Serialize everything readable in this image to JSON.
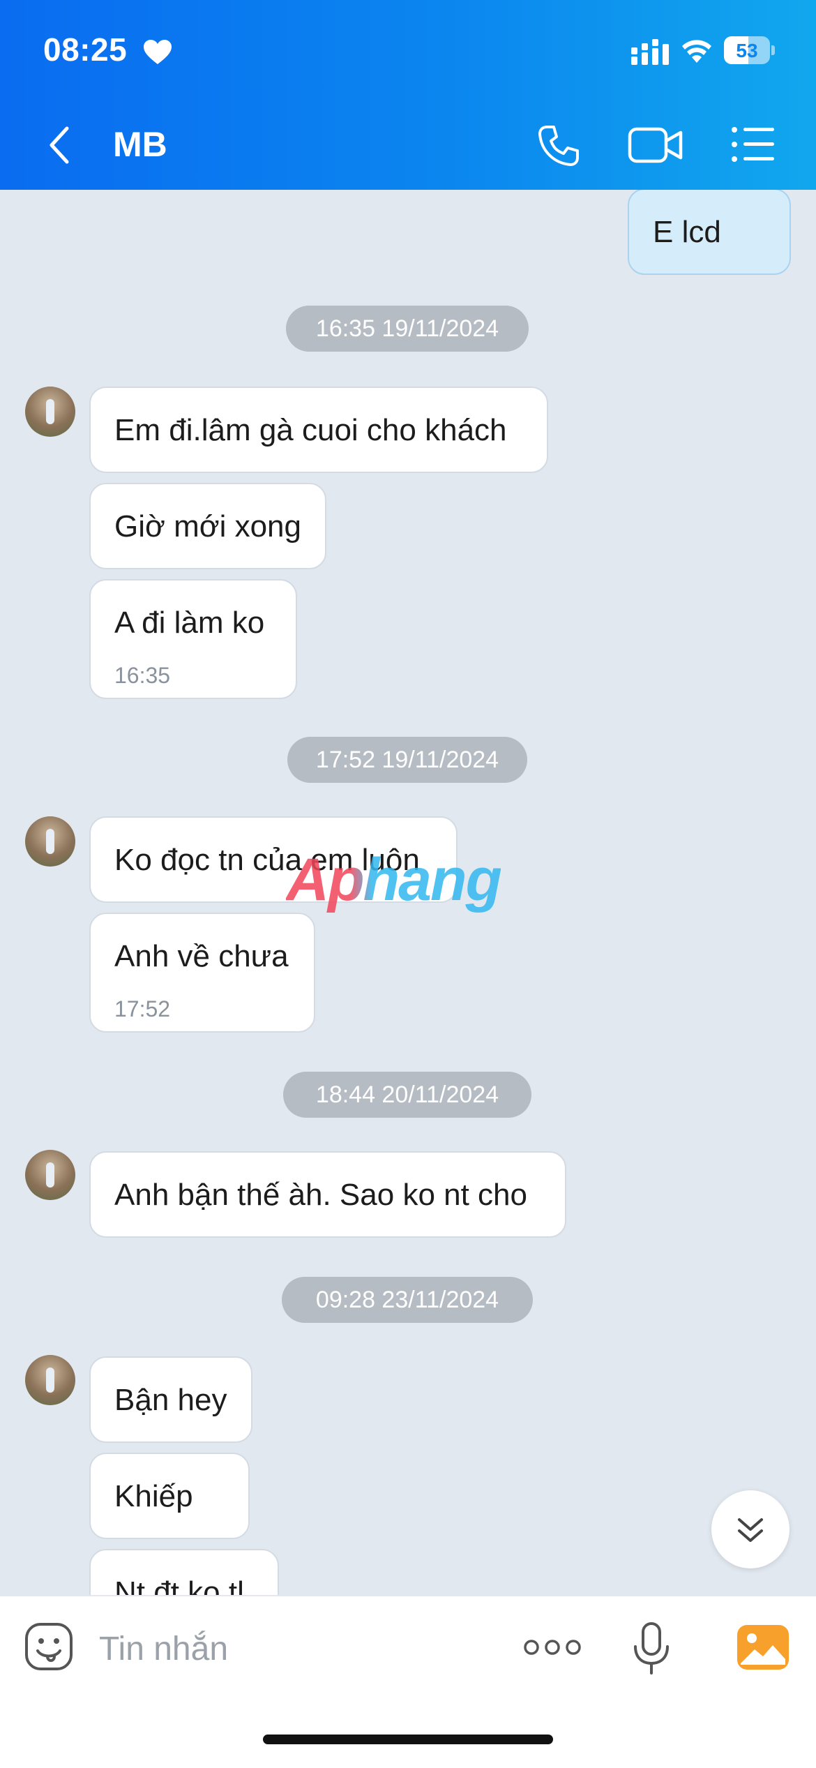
{
  "status_bar": {
    "time": "08:25",
    "battery": "53",
    "battery_level": 0.53
  },
  "header": {
    "contact_name": "MB"
  },
  "messages": [
    {
      "text": "E lcd",
      "mine": true
    },
    {
      "timestamp": "16:35 19/11/2024"
    },
    {
      "text": "Em đi.lâm gà cuoi cho khách"
    },
    {
      "text": "Giờ mới xong"
    },
    {
      "text": "A đi làm ko",
      "time": "16:35"
    },
    {
      "timestamp": "17:52 19/11/2024"
    },
    {
      "text": "Ko đọc tn của em luôn"
    },
    {
      "text": "Anh về chưa",
      "time": "17:52"
    },
    {
      "timestamp": "18:44 20/11/2024"
    },
    {
      "text": "Anh bận thế àh. Sao ko nt cho"
    },
    {
      "timestamp": "09:28 23/11/2024"
    },
    {
      "text": "Bận hey"
    },
    {
      "text": "Khiếp"
    },
    {
      "text": "Nt đt ko tl"
    }
  ],
  "watermark": "Aphang",
  "composer": {
    "placeholder": "Tin nhắn"
  },
  "colors": {
    "header_start": "#0a6cf0",
    "header_end": "#11a7ee",
    "chat_background": "#e2e8f0",
    "my_bubble": "#d5edfb",
    "their_bubble": "#ffffff",
    "timestamp_pill": "#b6bcc4",
    "image_button": "#f7a12c"
  }
}
